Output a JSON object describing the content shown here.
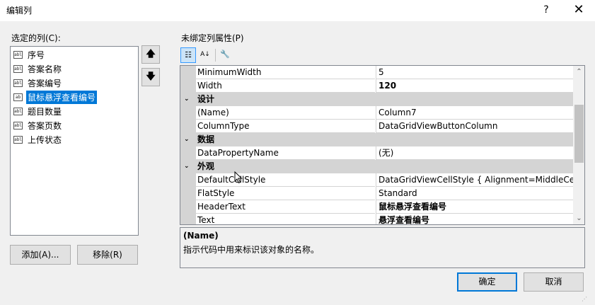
{
  "window": {
    "title": "编辑列",
    "help": "?",
    "close": "✕"
  },
  "left": {
    "label": "选定的列(C):",
    "items": [
      {
        "icon": "abl",
        "label": "序号",
        "selected": false
      },
      {
        "icon": "abl",
        "label": "答案名称",
        "selected": false
      },
      {
        "icon": "abl",
        "label": "答案编号",
        "selected": false
      },
      {
        "icon": "ab",
        "label": "鼠标悬浮查看编号",
        "selected": true
      },
      {
        "icon": "abl",
        "label": "题目数量",
        "selected": false
      },
      {
        "icon": "abl",
        "label": "答案页数",
        "selected": false
      },
      {
        "icon": "abl",
        "label": "上传状态",
        "selected": false
      }
    ],
    "up_arrow": "🡅",
    "down_arrow": "🡇",
    "add_label": "添加(A)...",
    "remove_label": "移除(R)"
  },
  "right": {
    "label": "未绑定列属性(P)",
    "toolbar": {
      "categorized_icon": "☷",
      "alphabetical_icon": "A↓",
      "properties_icon": "🔧"
    },
    "grid": {
      "row1": {
        "name": "MinimumWidth",
        "value": "5"
      },
      "row2": {
        "name": "Width",
        "value": "120"
      },
      "cat_design": "设计",
      "row3": {
        "name": "(Name)",
        "value": "Column7"
      },
      "row4": {
        "name": "ColumnType",
        "value": "DataGridViewButtonColumn"
      },
      "cat_data": "数据",
      "row5": {
        "name": "DataPropertyName",
        "value": "(无)"
      },
      "cat_appearance": "外观",
      "row6": {
        "name": "DefaultCellStyle",
        "value": "DataGridViewCellStyle { Alignment=MiddleCente"
      },
      "row7": {
        "name": "FlatStyle",
        "value": "Standard"
      },
      "row8": {
        "name": "HeaderText",
        "value": "鼠标悬浮查看编号"
      },
      "row9": {
        "name": "Text",
        "value": "悬浮查看编号"
      },
      "expander": "⌄",
      "scroll_up": "⌃",
      "scroll_down": "⌄"
    },
    "description": {
      "title": "(Name)",
      "text": "指示代码中用来标识该对象的名称。"
    }
  },
  "footer": {
    "ok_label": "确定",
    "cancel_label": "取消",
    "grip": "⋰"
  }
}
